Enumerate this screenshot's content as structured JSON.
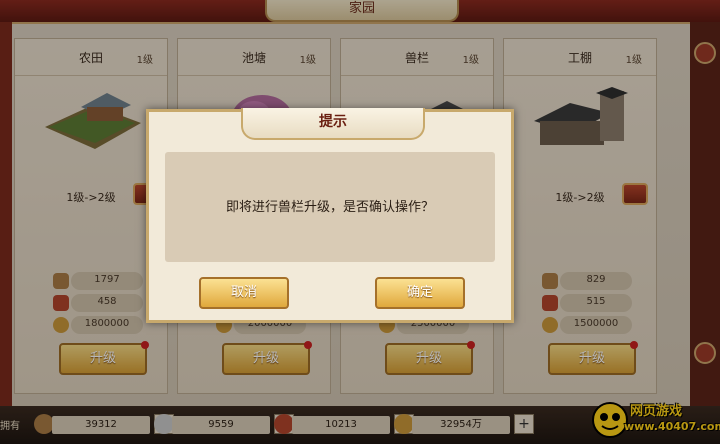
{
  "header": {
    "title": "家园"
  },
  "cards": [
    {
      "name": "农田",
      "level": "1级",
      "upgrade": "1级->2级",
      "resources": [
        "1797",
        "458",
        "1800000"
      ],
      "upgrade_label": "升级"
    },
    {
      "name": "池塘",
      "level": "1级",
      "upgrade": "",
      "resources": [
        "",
        "",
        "2000000"
      ],
      "upgrade_label": "升级"
    },
    {
      "name": "兽栏",
      "level": "1级",
      "upgrade": "",
      "resources": [
        "",
        "",
        "2500000"
      ],
      "upgrade_label": "升级"
    },
    {
      "name": "工棚",
      "level": "1级",
      "upgrade": "1级->2级",
      "resources": [
        "829",
        "515",
        "1500000"
      ],
      "upgrade_label": "升级"
    }
  ],
  "bottom_bar": {
    "own_label": "拥有",
    "resources": [
      {
        "icon": "wood-icon",
        "value": "39312"
      },
      {
        "icon": "stone-icon",
        "value": "9559"
      },
      {
        "icon": "cloth-icon",
        "value": "10213"
      },
      {
        "icon": "coin-icon",
        "value": "32954万"
      }
    ],
    "plus": "+"
  },
  "dialog": {
    "title": "提示",
    "message": "即将进行兽栏升级，是否确认操作？",
    "cancel_label": "取消",
    "confirm_label": "确定"
  },
  "watermark": {
    "text_cn": "网页游戏",
    "text_url": "www.40407.com"
  },
  "colors": {
    "frame_red": "#7a2a1c",
    "button_gold": "#e0a83c",
    "dialog_bg": "#f2ead9"
  }
}
